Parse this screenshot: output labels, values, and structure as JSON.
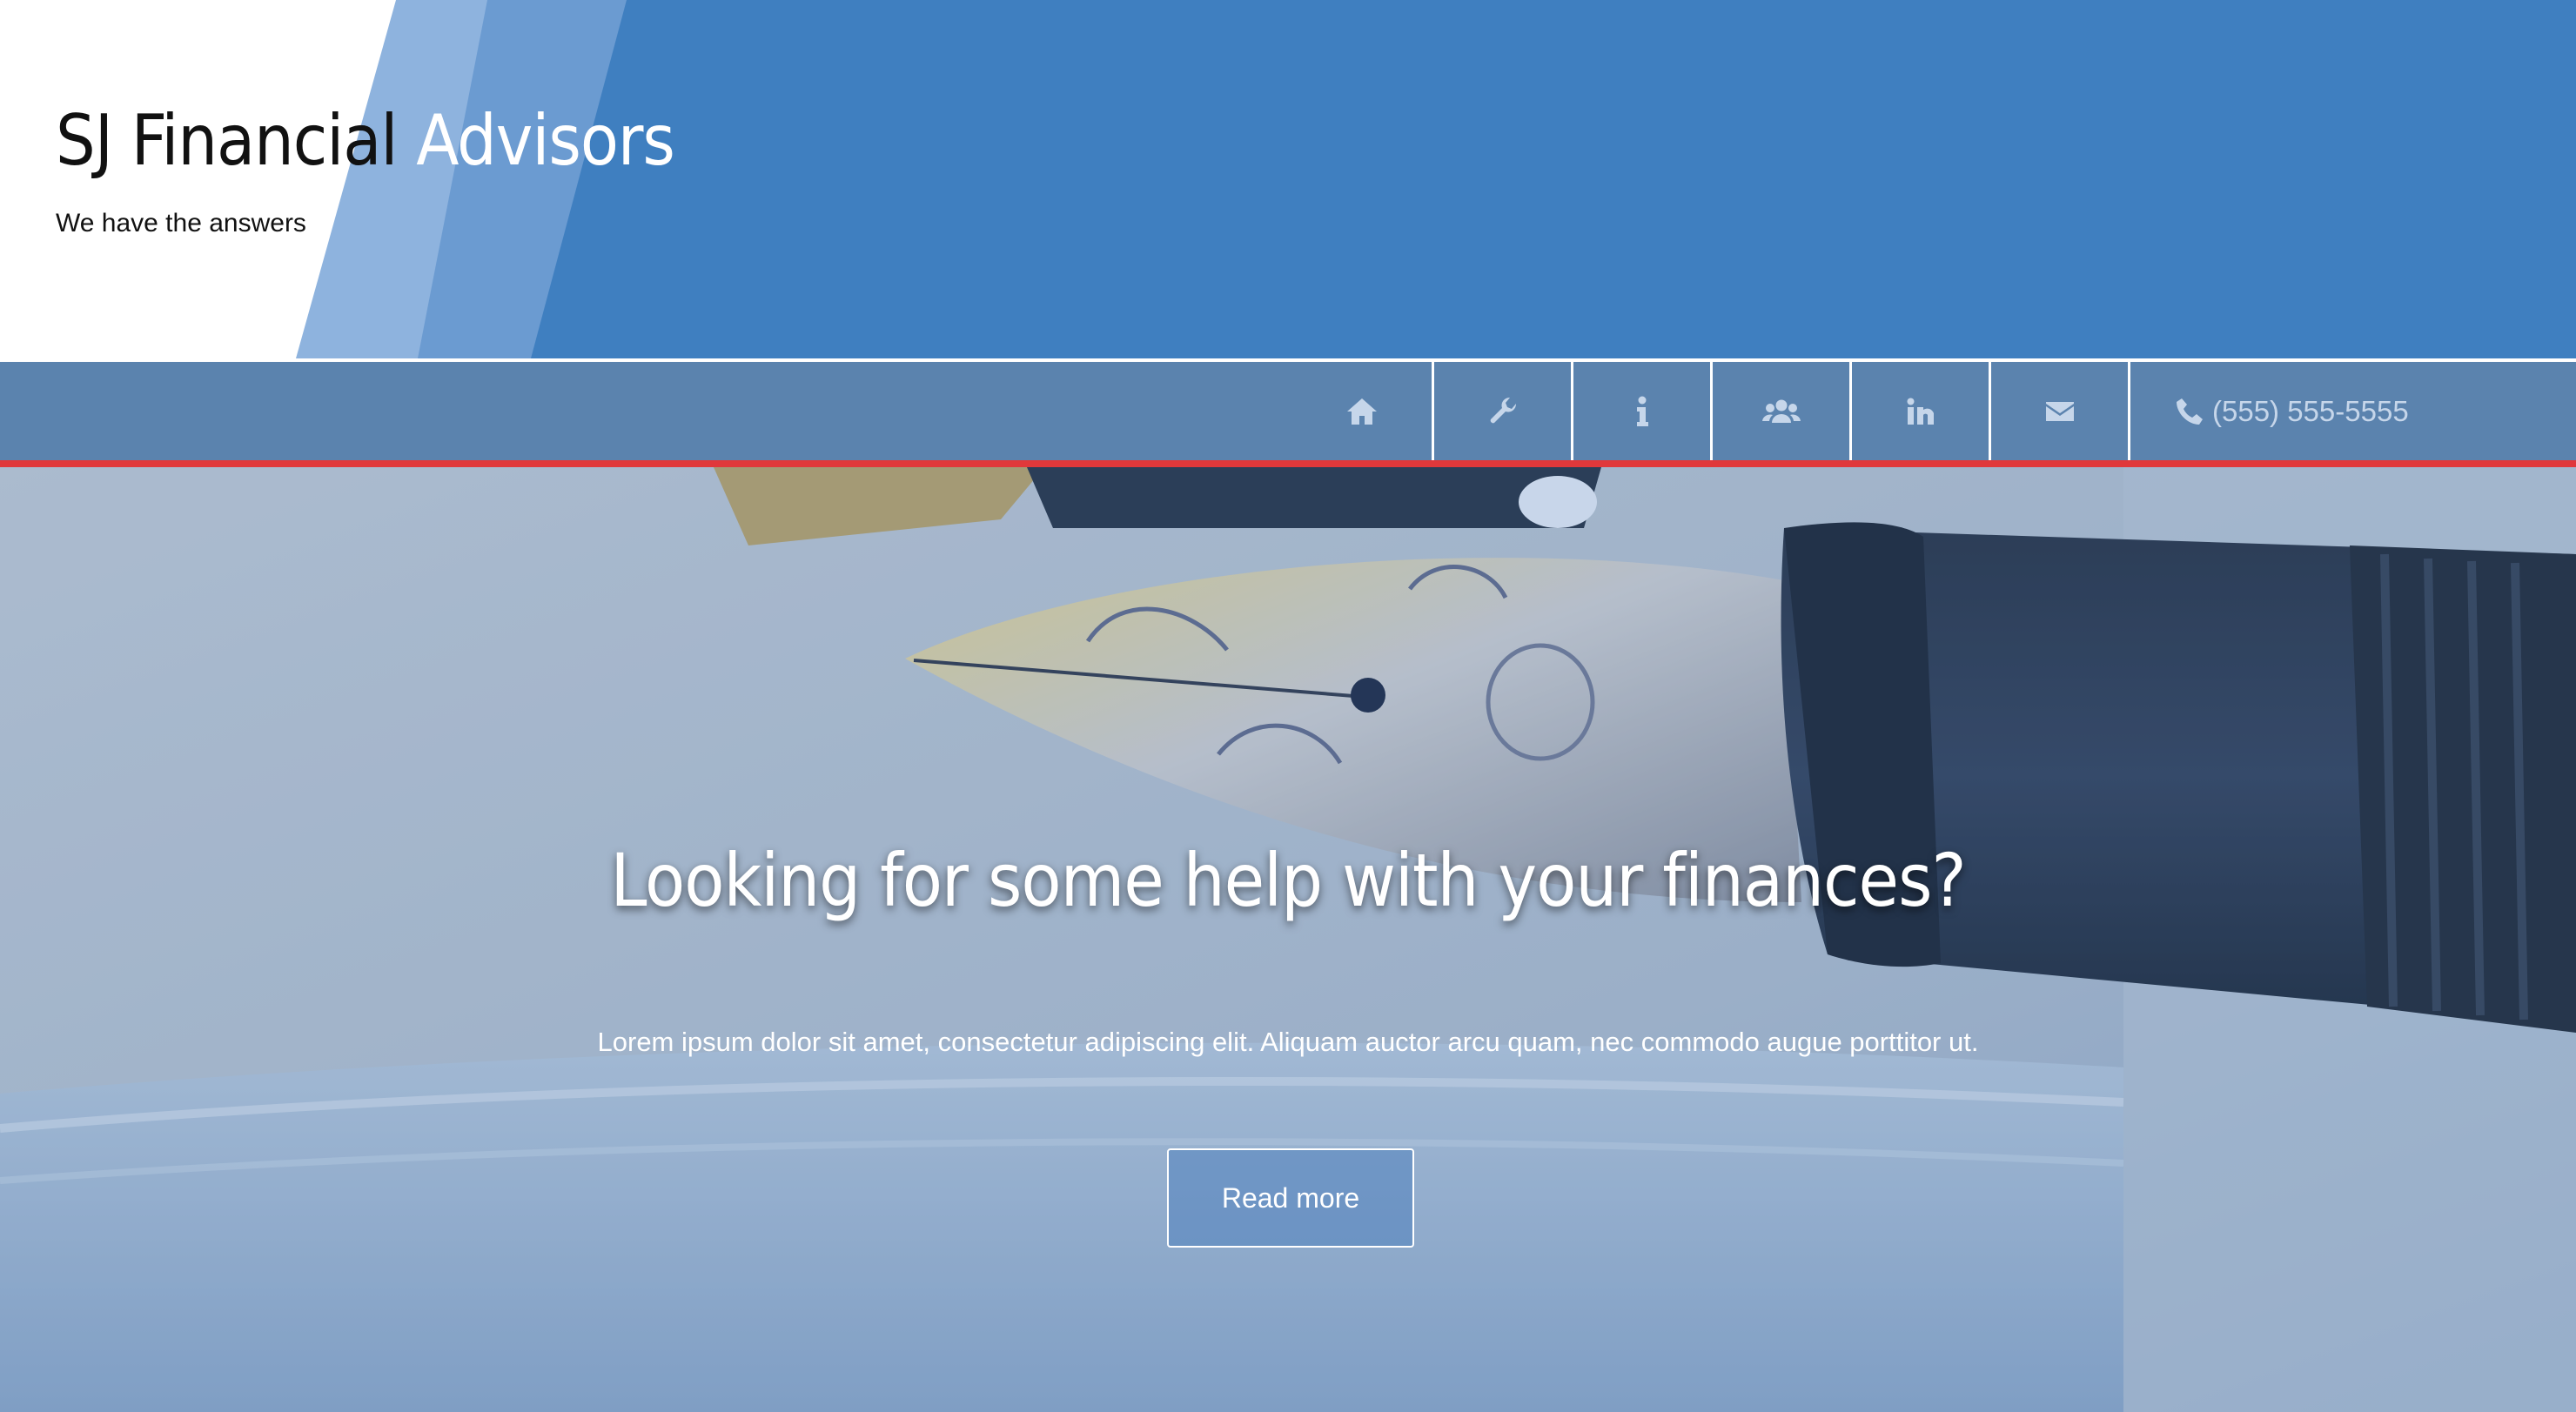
{
  "colors": {
    "header_blue": "#3f7fc0",
    "stripe_light": "#8eb3de",
    "stripe_mid": "#6b9bd1",
    "nav_bar": "#5b83ae",
    "nav_accent": "#e0383b",
    "nav_icon": "#c6d6ea",
    "hero_text": "#ffffff"
  },
  "header": {
    "brand_part1": "SJ Financial",
    "brand_part2": "Advisors",
    "tagline": "We have the answers"
  },
  "nav": {
    "items": [
      {
        "icon": "home-icon"
      },
      {
        "icon": "wrench-icon"
      },
      {
        "icon": "info-icon"
      },
      {
        "icon": "users-icon"
      },
      {
        "icon": "linkedin-icon"
      },
      {
        "icon": "envelope-icon"
      }
    ],
    "phone": {
      "icon": "phone-icon",
      "label": "(555) 555-5555"
    }
  },
  "hero": {
    "title": "Looking for some help with your finances?",
    "text": "Lorem ipsum dolor sit amet, consectetur adipiscing elit. Aliquam auctor arcu quam, nec commodo augue porttitor ut.",
    "button_label": "Read more",
    "background": "fountain-pen-photo"
  }
}
